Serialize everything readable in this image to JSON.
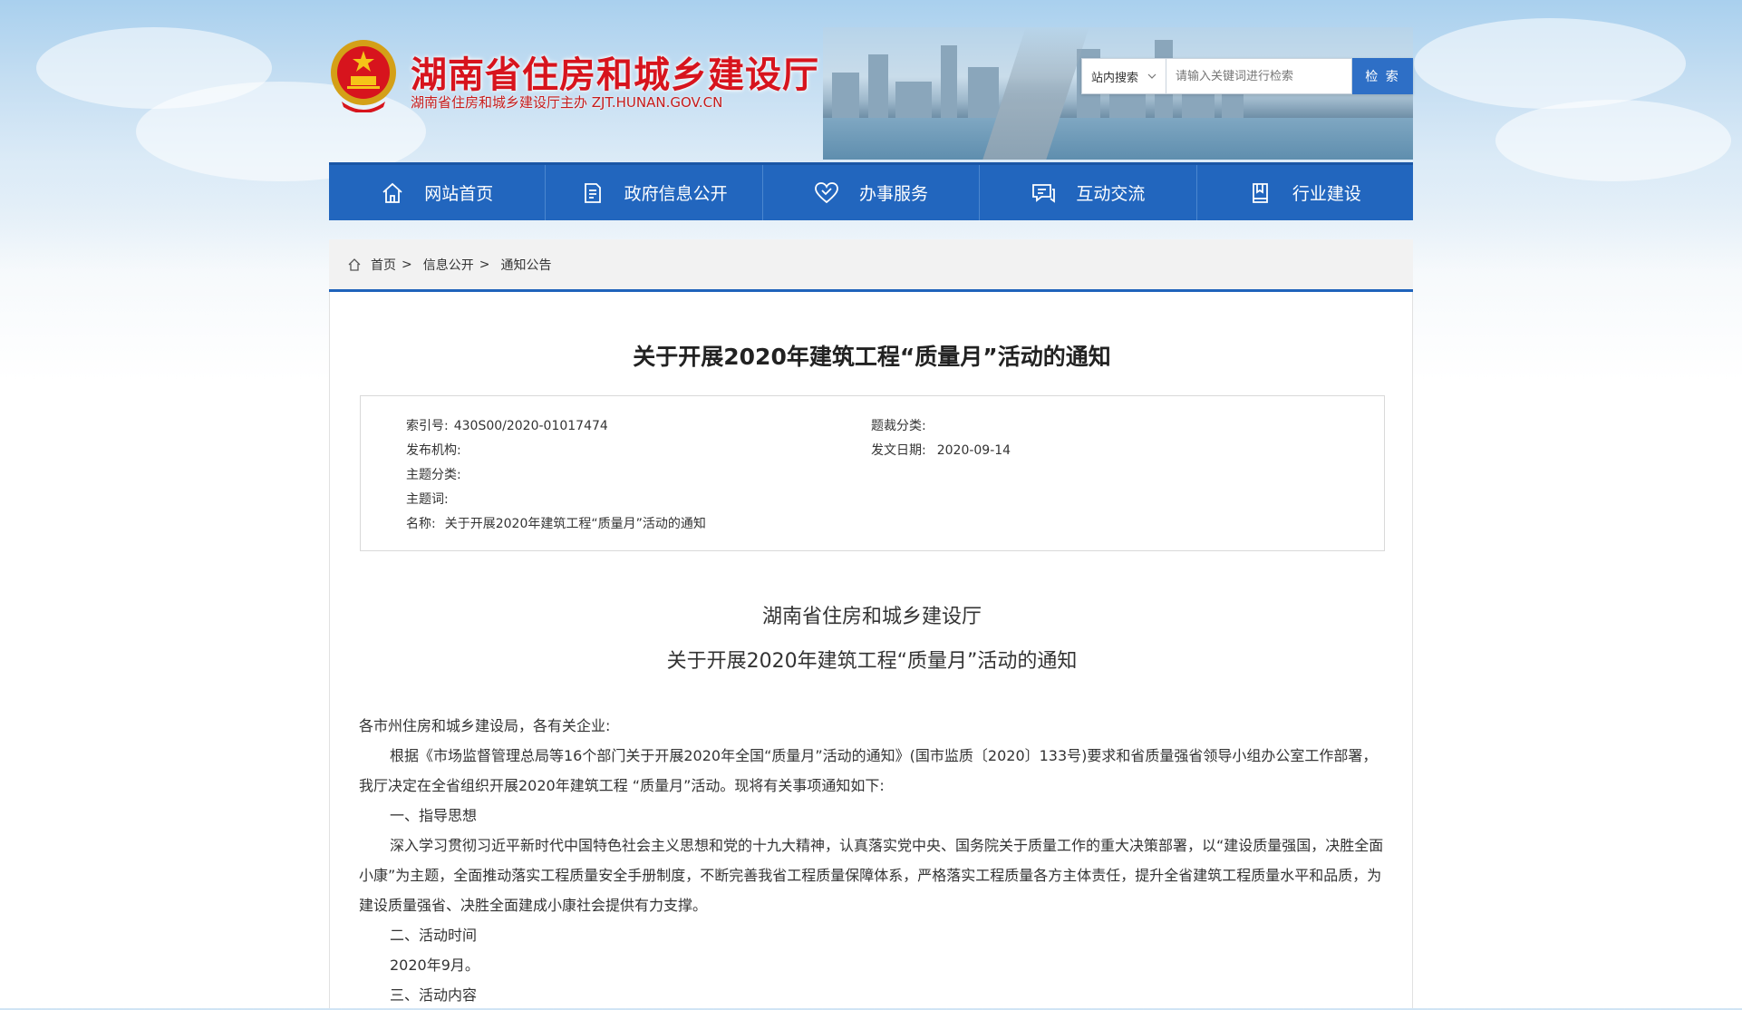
{
  "header": {
    "site_title": "湖南省住房和城乡建设厅",
    "site_subtitle": "湖南省住房和城乡建设厅主办  ZJT.HUNAN.GOV.CN"
  },
  "search": {
    "scope": "站内搜索",
    "placeholder": "请输入关键词进行检索",
    "button": "检 索"
  },
  "nav": [
    {
      "label": "网站首页",
      "icon": "home-icon"
    },
    {
      "label": "政府信息公开",
      "icon": "document-icon"
    },
    {
      "label": "办事服务",
      "icon": "heart-icon"
    },
    {
      "label": "互动交流",
      "icon": "chat-icon"
    },
    {
      "label": "行业建设",
      "icon": "book-icon"
    }
  ],
  "breadcrumb": [
    "首页",
    "信息公开",
    "通知公告"
  ],
  "article": {
    "title": "关于开展2020年建筑工程“质量月”活动的通知",
    "meta": {
      "index_label": "索引号:",
      "index_value": "430S00/2020-01017474",
      "genre_label": "题裁分类:",
      "genre_value": "",
      "publisher_label": "发布机构:",
      "publisher_value": "",
      "date_label": "发文日期:",
      "date_value": "2020-09-14",
      "topic_label": "主题分类:",
      "topic_value": "",
      "keyword_label": "主题词:",
      "keyword_value": "",
      "name_label": "名称:",
      "name_value": "关于开展2020年建筑工程“质量月”活动的通知"
    },
    "body_title_1": "湖南省住房和城乡建设厅",
    "body_title_2": "关于开展2020年建筑工程“质量月”活动的通知",
    "salutation": "各市州住房和城乡建设局，各有关企业:",
    "p1": "根据《市场监督管理总局等16个部门关于开展2020年全国“质量月”活动的通知》(国市监质〔2020〕133号)要求和省质量强省领导小组办公室工作部署，我厅决定在全省组织开展2020年建筑工程 “质量月”活动。现将有关事项通知如下:",
    "h1": "一、指导思想",
    "p2": "深入学习贯彻习近平新时代中国特色社会主义思想和党的十九大精神，认真落实党中央、国务院关于质量工作的重大决策部署，以“建设质量强国，决胜全面小康”为主题，全面推动落实工程质量安全手册制度，不断完善我省工程质量保障体系，严格落实工程质量各方主体责任，提升全省建筑工程质量水平和品质，为建设质量强省、决胜全面建成小康社会提供有力支撑。",
    "h2": "二、活动时间",
    "p3": "2020年9月。",
    "h3": "三、活动内容"
  }
}
